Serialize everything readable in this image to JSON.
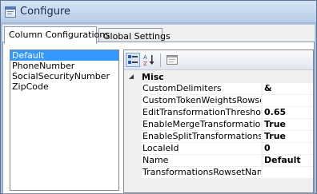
{
  "window": {
    "title": "Configure"
  },
  "tabs": [
    {
      "label": "Column Configurations",
      "active": true
    },
    {
      "label": "Global Settings",
      "active": false
    }
  ],
  "columns_list": {
    "items": [
      "Default",
      "PhoneNumber",
      "SocialSecurityNumber",
      "ZipCode"
    ],
    "selected": "Default"
  },
  "property_grid": {
    "toolbar": {
      "categorized_icon": "categorized-icon",
      "alphabetical_icon": "alphabetical-icon",
      "property_pages_icon": "property-pages-icon"
    },
    "category": "Misc",
    "properties": [
      {
        "name": "CustomDelimiters",
        "value": "&"
      },
      {
        "name": "CustomTokenWeightsRowsetNam",
        "value": ""
      },
      {
        "name": "EditTransformationThreshold",
        "value": "0.65"
      },
      {
        "name": "EnableMergeTransformations",
        "value": "True"
      },
      {
        "name": "EnableSplitTransformations",
        "value": "True"
      },
      {
        "name": "LocaleId",
        "value": "0"
      },
      {
        "name": "Name",
        "value": "Default"
      },
      {
        "name": "TransformationsRowsetName",
        "value": ""
      }
    ]
  },
  "colors": {
    "selection": "#3399ff",
    "window_frame": "#a7c0e1"
  }
}
